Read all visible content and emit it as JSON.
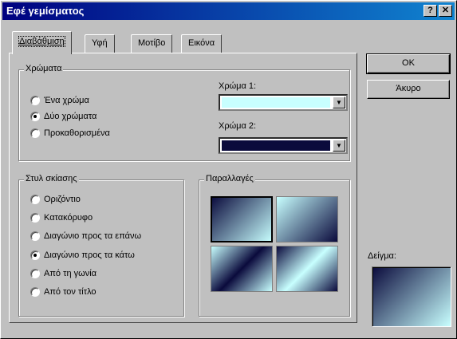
{
  "window": {
    "title": "Εφέ γεμίσματος",
    "help_label": "?",
    "close_label": "✕"
  },
  "tabs": [
    {
      "label": "Διαβάθμιση",
      "active": true
    },
    {
      "label": "Υφή"
    },
    {
      "label": "Μοτίβο"
    },
    {
      "label": "Εικόνα"
    }
  ],
  "colors_group": {
    "label": "Χρώματα",
    "options": [
      {
        "label": "Ένα χρώμα",
        "checked": false
      },
      {
        "label": "Δύο χρώματα",
        "checked": true
      },
      {
        "label": "Προκαθορισμένα",
        "checked": false
      }
    ],
    "color1": {
      "label": "Χρώμα 1:",
      "value": "#c8ffff"
    },
    "color2": {
      "label": "Χρώμα 2:",
      "value": "#0a0a3c"
    }
  },
  "shading_group": {
    "label": "Στυλ σκίασης",
    "options": [
      {
        "label": "Οριζόντιο",
        "checked": false
      },
      {
        "label": "Κατακόρυφο",
        "checked": false
      },
      {
        "label": "Διαγώνιο προς τα επάνω",
        "checked": false
      },
      {
        "label": "Διαγώνιο προς τα κάτω",
        "checked": true
      },
      {
        "label": "Από τη γωνία",
        "checked": false
      },
      {
        "label": "Από τον τίτλο",
        "checked": false
      }
    ]
  },
  "variants_group": {
    "label": "Παραλλαγές",
    "selected_index": 0
  },
  "buttons": {
    "ok": "OK",
    "cancel": "Άκυρο"
  },
  "sample": {
    "label": "Δείγμα:"
  },
  "colors": {
    "titlebar": "#000080",
    "dialog": "#c0c0c0"
  }
}
